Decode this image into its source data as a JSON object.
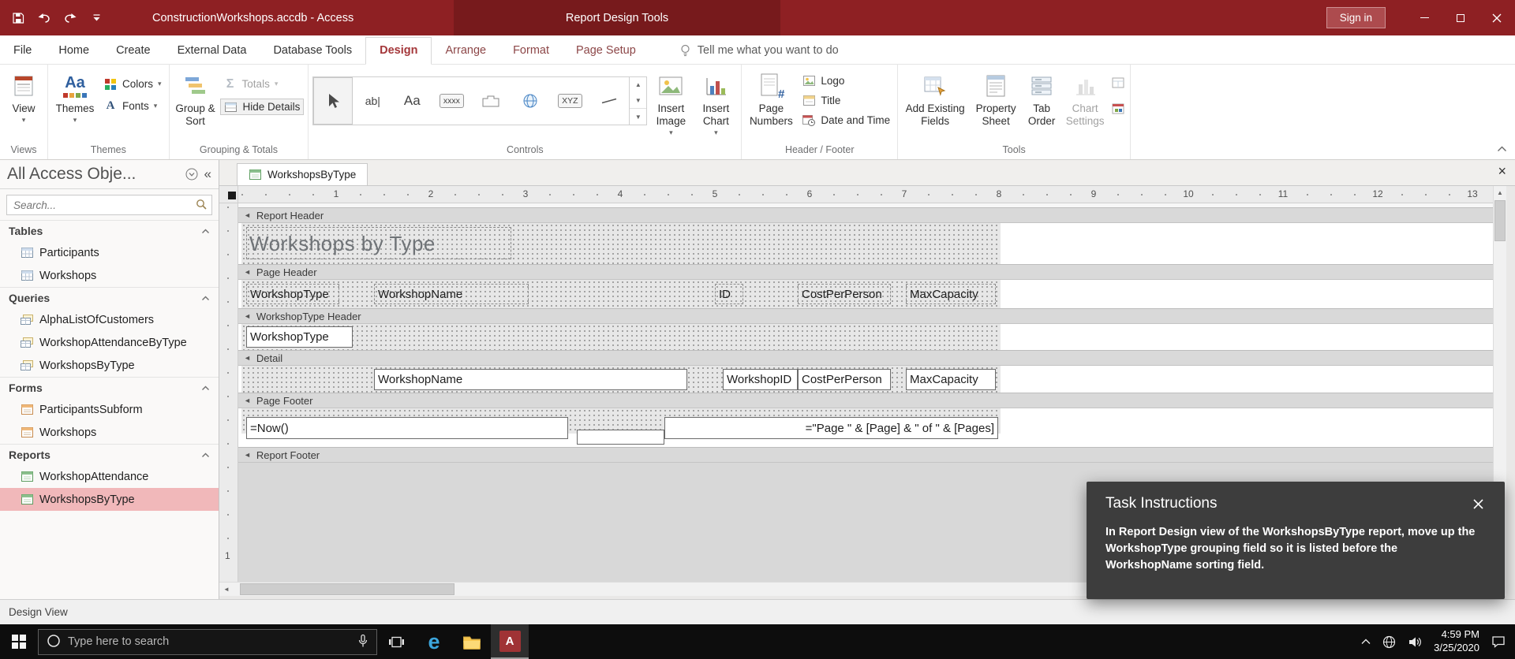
{
  "icons": {
    "dropdown": "▾",
    "nav_collapse": "«",
    "close": "×",
    "up": "▲",
    "down": "▼",
    "left": "◄",
    "right": "►",
    "section_arrow": "◄"
  },
  "titlebar": {
    "title": "ConstructionWorkshops.accdb - Access",
    "contextual_title": "Report Design Tools",
    "sign_in_label": "Sign in"
  },
  "ribbon": {
    "tabs": [
      {
        "label": "File"
      },
      {
        "label": "Home"
      },
      {
        "label": "Create"
      },
      {
        "label": "External Data"
      },
      {
        "label": "Database Tools"
      },
      {
        "label": "Design"
      },
      {
        "label": "Arrange"
      },
      {
        "label": "Format"
      },
      {
        "label": "Page Setup"
      }
    ],
    "tell_me": "Tell me what you want to do",
    "glyphs": {
      "sigma": "Σ",
      "aa": "Aa",
      "a_letter": "A",
      "ab": "ab|",
      "xxxx": "xxxx",
      "xyz": "XYZ",
      "hash": "#"
    },
    "buttons": {
      "view": "View",
      "themes": "Themes",
      "colors": "Colors",
      "fonts": "Fonts",
      "group_sort": "Group & Sort",
      "totals": "Totals",
      "hide_details": "Hide Details",
      "insert_image": "Insert Image",
      "insert_chart": "Insert Chart",
      "page_numbers": "Page Numbers",
      "logo": "Logo",
      "title": "Title",
      "date_time": "Date and Time",
      "add_fields": "Add Existing Fields",
      "property_sheet": "Property Sheet",
      "tab_order": "Tab Order",
      "chart_settings": "Chart Settings"
    },
    "group_labels": [
      "Views",
      "Themes",
      "Grouping & Totals",
      "Controls",
      "Header / Footer",
      "Tools"
    ]
  },
  "nav": {
    "title": "All Access Obje...",
    "search_placeholder": "Search...",
    "sections": [
      {
        "label": "Tables",
        "items": [
          {
            "label": "Participants"
          },
          {
            "label": "Workshops"
          }
        ]
      },
      {
        "label": "Queries",
        "items": [
          {
            "label": "AlphaListOfCustomers"
          },
          {
            "label": "WorkshopAttendanceByType"
          },
          {
            "label": "WorkshopsByType"
          }
        ]
      },
      {
        "label": "Forms",
        "items": [
          {
            "label": "ParticipantsSubform"
          },
          {
            "label": "Workshops"
          }
        ]
      },
      {
        "label": "Reports",
        "items": [
          {
            "label": "WorkshopAttendance"
          },
          {
            "label": "WorkshopsByType"
          }
        ]
      }
    ]
  },
  "design": {
    "doc_tab": "WorkshopsByType",
    "ruler": [
      "1",
      "2",
      "3",
      "4",
      "5",
      "6",
      "7",
      "8",
      "9",
      "10",
      "11",
      "12",
      "13"
    ],
    "vruler": [
      "1"
    ],
    "sections": {
      "report_header": "Report Header",
      "page_header": "Page Header",
      "group_header": "WorkshopType Header",
      "detail": "Detail",
      "page_footer": "Page Footer",
      "report_footer": "Report Footer"
    },
    "report_title": "Workshops by Type",
    "page_header_labels": [
      "WorkshopType",
      "WorkshopName",
      "ID",
      "CostPerPerson",
      "MaxCapacity"
    ],
    "group_field": "WorkshopType",
    "detail_fields": [
      "WorkshopName",
      "WorkshopID",
      "CostPerPerson",
      "MaxCapacity"
    ],
    "footer_left": "=Now()",
    "footer_right": "=\"Page \" & [Page] & \" of \" & [Pages]"
  },
  "popup": {
    "title": "Task Instructions",
    "body": "In Report Design view of the WorkshopsByType report, move up the WorkshopType grouping field so it is listed before the WorkshopName sorting field."
  },
  "statusbar": {
    "view_label": "Design View"
  },
  "taskbar": {
    "search_placeholder": "Type here to search",
    "edge_letter": "e",
    "access_letter": "A",
    "time": "4:59 PM",
    "date": "3/25/2020"
  }
}
